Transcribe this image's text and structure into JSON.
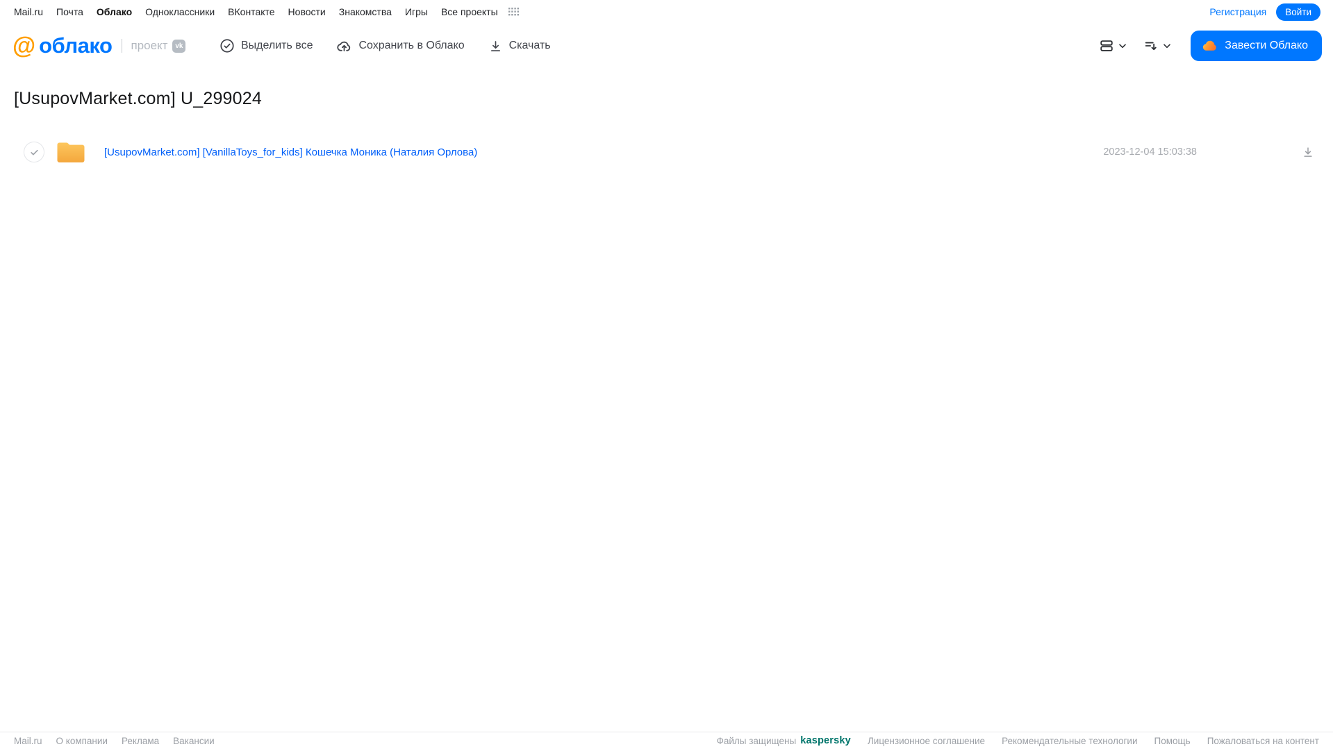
{
  "topnav": {
    "links": [
      "Mail.ru",
      "Почта",
      "Облако",
      "Одноклассники",
      "ВКонтакте",
      "Новости",
      "Знакомства",
      "Игры",
      "Все проекты"
    ],
    "active_link": "Облако",
    "registration_label": "Регистрация",
    "login_label": "Войти"
  },
  "header": {
    "logo_at": "@",
    "logo_text": "облако",
    "project_label": "проект",
    "vk_badge": "vk",
    "actions": [
      {
        "label": "Выделить все",
        "icon": "check-circle-icon"
      },
      {
        "label": "Сохранить в Облако",
        "icon": "cloud-upload-icon"
      },
      {
        "label": "Скачать",
        "icon": "download-icon"
      }
    ],
    "view_controls": [
      "list-view-icon",
      "sort-icon"
    ],
    "get_cloud_label": "Завести Облако"
  },
  "main": {
    "title": "[UsupovMarket.com] U_299024",
    "files": [
      {
        "type": "folder",
        "name": "[UsupovMarket.com] [VanillaToys_for_kids] Кошечка Моника (Наталия Орлова)",
        "date": "2023-12-04 15:03:38"
      }
    ]
  },
  "footer": {
    "left_links": [
      "Mail.ru",
      "О компании",
      "Реклама",
      "Вакансии"
    ],
    "protected_label": "Файлы защищены",
    "kaspersky_label": "kaspersky",
    "right_links": [
      "Лицензионное соглашение",
      "Рекомендательные технологии",
      "Помощь",
      "Пожаловаться на контент"
    ]
  },
  "colors": {
    "accent_blue": "#0077ff",
    "link_blue": "#005ff9",
    "logo_orange": "#ff9e00",
    "folder_top": "#fdc75e",
    "folder_bottom": "#f4a73d",
    "kaspersky_teal": "#00756b"
  }
}
